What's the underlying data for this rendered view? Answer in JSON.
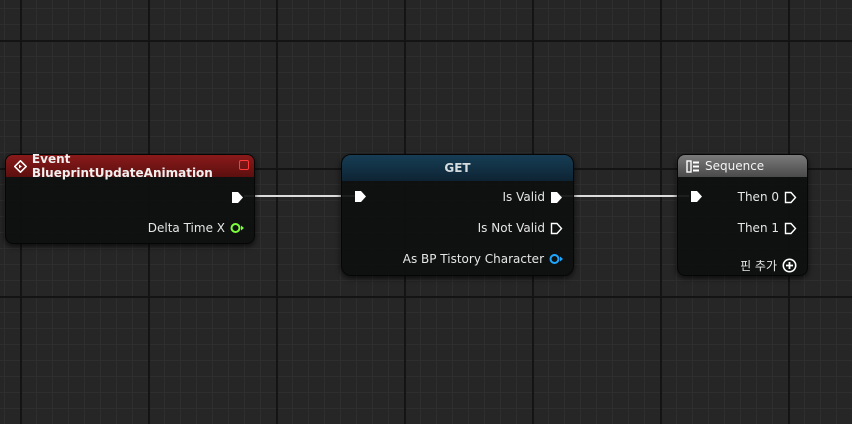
{
  "nodes": {
    "event": {
      "title": "Event BlueprintUpdateAnimation",
      "pins": {
        "delta_time": "Delta Time X"
      }
    },
    "get": {
      "title": "GET",
      "pins": {
        "is_valid": "Is Valid",
        "is_not_valid": "Is Not Valid",
        "as_character": "As BP Tistory Character"
      }
    },
    "sequence": {
      "title": "Sequence",
      "pins": {
        "then_0": "Then 0",
        "then_1": "Then 1",
        "add_pin": "핀 추가"
      }
    }
  },
  "colors": {
    "background": "#262626",
    "event_header": "#8a1a1a",
    "get_header": "#163d55",
    "sequence_header": "#7a7a7a",
    "exec_wire": "#dcdcdc",
    "float_pin": "#7cff3a",
    "object_pin": "#1fa8ff",
    "close_icon": "#ff3b3b"
  },
  "icons": {
    "event": "event-diamond-icon",
    "sequence": "sequence-icon",
    "exec_pin": "exec-pin-icon",
    "data_pin": "data-pin-icon",
    "add_pin": "plus-circle-icon"
  }
}
